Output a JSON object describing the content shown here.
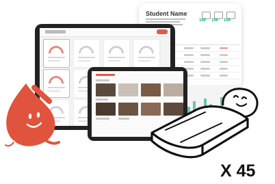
{
  "report": {
    "student_name": "Student Name",
    "stat_values": [
      "100",
      "100",
      "100"
    ]
  },
  "multiplier_text": "X 45",
  "illustrations": {
    "left": "red-drop-mascot",
    "right": "turtle-shell-box-character"
  },
  "colors": {
    "accent_red": "#e05a49",
    "accent_teal": "#16a48b",
    "mascot_red": "#e0533c",
    "device_frame": "#222222"
  }
}
